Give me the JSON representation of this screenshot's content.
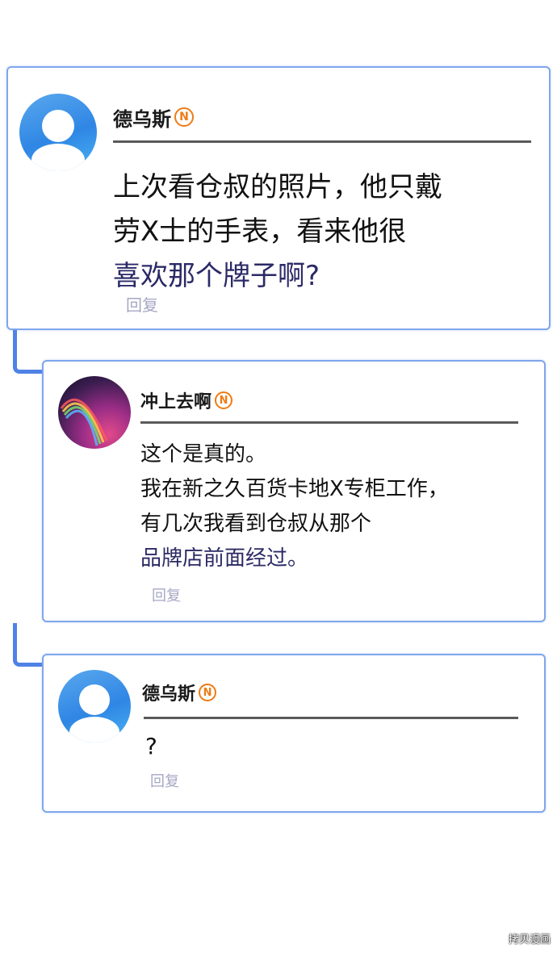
{
  "comments": [
    {
      "user": "德乌斯",
      "badge": "N",
      "lines": [
        "上次看仓叔的照片，他只戴",
        "劳X士的手表，看来他很",
        "喜欢那个牌子啊?"
      ],
      "reply": "回复"
    },
    {
      "user": "冲上去啊",
      "badge": "N",
      "lines": [
        "这个是真的。",
        "我在新之久百货卡地X专柜工作，",
        "有几次我看到仓叔从那个",
        "品牌店前面经过。"
      ],
      "reply": "回复"
    },
    {
      "user": "德乌斯",
      "badge": "N",
      "lines": [
        "?"
      ],
      "reply": "回复"
    }
  ],
  "watermark": "拷贝漫画",
  "colors": {
    "card_border": "#7fa6ec",
    "connector": "#4f82e6",
    "badge": "#ef7b14",
    "reply": "#a6a7c4"
  }
}
